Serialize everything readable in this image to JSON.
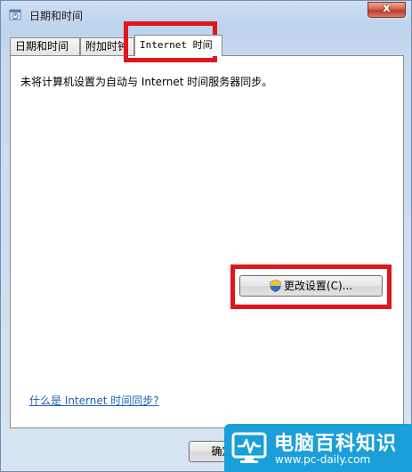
{
  "window": {
    "title": "日期和时间",
    "close_label": "x"
  },
  "tabs": [
    {
      "label": "日期和时间"
    },
    {
      "label": "附加时钟"
    },
    {
      "label": "Internet 时间"
    }
  ],
  "panel": {
    "status_text": "未将计算机设置为自动与 Internet 时间服务器同步。",
    "change_button_label": "更改设置(C)...",
    "help_link": "什么是 Internet 时间同步?"
  },
  "footer": {
    "ok_button_label": "确定"
  },
  "watermark": {
    "title": "电脑百科知识",
    "url": "www.pc-daily.com"
  },
  "colors": {
    "highlight": "#e0161c",
    "link": "#1f5fb4",
    "watermark_bg": "#1a9fd9"
  }
}
